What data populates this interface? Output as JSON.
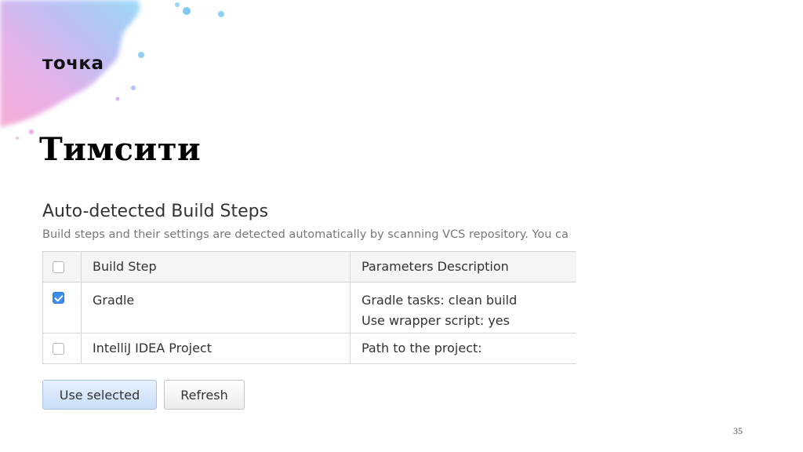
{
  "slide": {
    "logo_text": "точка",
    "title": "Тимсити",
    "page_number": "35"
  },
  "screenshot": {
    "heading": "Auto-detected Build Steps",
    "description": "Build steps and their settings are detected automatically by scanning VCS repository. You ca",
    "columns": [
      "Build Step",
      "Parameters Description"
    ],
    "rows": [
      {
        "checked": true,
        "step": "Gradle",
        "params": [
          "Gradle tasks: clean build",
          "Use wrapper script: yes"
        ]
      },
      {
        "checked": false,
        "step": "IntelliJ IDEA Project",
        "params": [
          "Path to the project:"
        ]
      }
    ],
    "buttons": {
      "use_selected": "Use selected",
      "refresh": "Refresh"
    }
  },
  "colors": {
    "checkbox_checked": "#3d8ee8",
    "primary_button": "#c9def7",
    "splash_pink": "#f3a6d4",
    "splash_blue": "#8fd2f6"
  }
}
